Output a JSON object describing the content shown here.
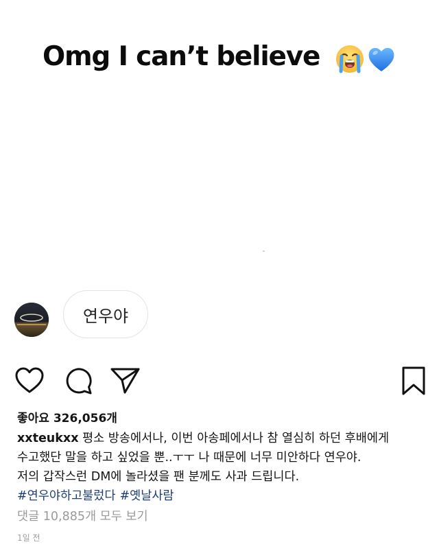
{
  "post": {
    "headline": "Omg I can’t believe",
    "emojis": [
      "loudly-crying-face-icon",
      "blue-heart-icon"
    ],
    "dm_bubble_text": "연우야"
  },
  "actions": {
    "icons": [
      "heart-icon",
      "comment-icon",
      "send-icon",
      "bookmark-icon"
    ]
  },
  "likes": {
    "text": "좋아요 326,056개"
  },
  "caption": {
    "username": "xxteukxx",
    "line1": " 평소 방송에서나, 이번 아송페에서나 참 열심히 하던 후배에게",
    "line2": "수고했단 말을 하고 싶었을 뿐..ㅜㅜ  나 때문에 너무 미안하다 연우야.",
    "line3": "저의 갑작스런 DM에 놀라셨을 팬 분께도 사과 드립니다.",
    "hashtags": [
      "#연우야하고불렀다",
      "#옛날사람"
    ]
  },
  "comments": {
    "view_all": "댓글 10,885개 모두 보기"
  },
  "timestamp": "1일 전",
  "colors": {
    "hashtag": "#1d3e78",
    "muted": "#9a9a9a",
    "heart_blue": "#2f8cf5"
  }
}
